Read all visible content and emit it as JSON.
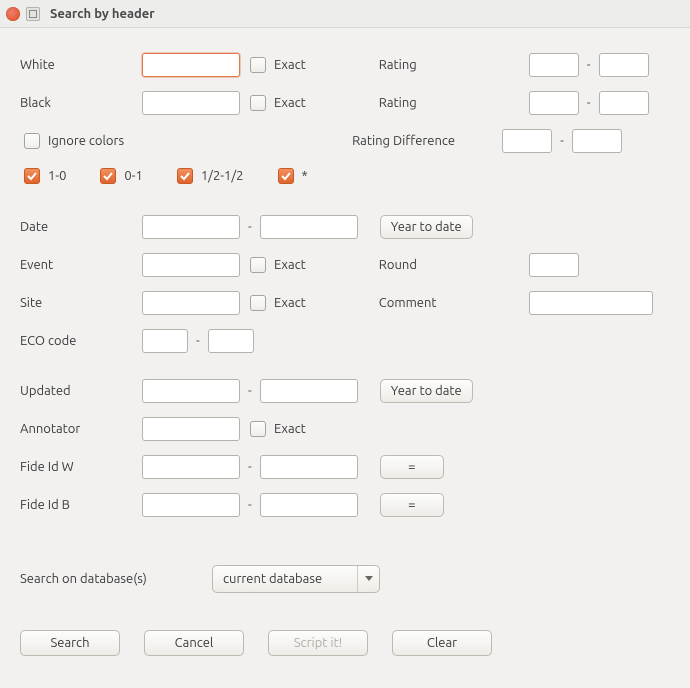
{
  "window": {
    "title": "Search by header"
  },
  "labels": {
    "white": "White",
    "black": "Black",
    "ignore_colors": "Ignore colors",
    "rating": "Rating",
    "rating2": "Rating",
    "rating_diff": "Rating Difference",
    "exact": "Exact",
    "date": "Date",
    "event": "Event",
    "site": "Site",
    "eco": "ECO code",
    "updated": "Updated",
    "annotator": "Annotator",
    "fide_w": "Fide Id W",
    "fide_b": "Fide Id B",
    "round": "Round",
    "comment": "Comment",
    "search_on": "Search on database(s)"
  },
  "results": {
    "r1": "1-0",
    "r2": "0-1",
    "r3": "1/2-1/2",
    "r4": "*"
  },
  "buttons": {
    "year_to_date": "Year to date",
    "year_to_date2": "Year to date",
    "eq1": "=",
    "eq2": "=",
    "search": "Search",
    "cancel": "Cancel",
    "script": "Script it!",
    "clear": "Clear"
  },
  "select": {
    "database": "current database"
  },
  "values": {
    "white": "",
    "black": "",
    "rating_w_from": "",
    "rating_w_to": "",
    "rating_b_from": "",
    "rating_b_to": "",
    "rating_diff_from": "",
    "rating_diff_to": "",
    "date_from": "",
    "date_to": "",
    "event": "",
    "site": "",
    "eco_from": "",
    "eco_to": "",
    "updated_from": "",
    "updated_to": "",
    "annotator": "",
    "fide_w_from": "",
    "fide_w_to": "",
    "fide_b_from": "",
    "fide_b_to": "",
    "round": "",
    "comment": ""
  }
}
